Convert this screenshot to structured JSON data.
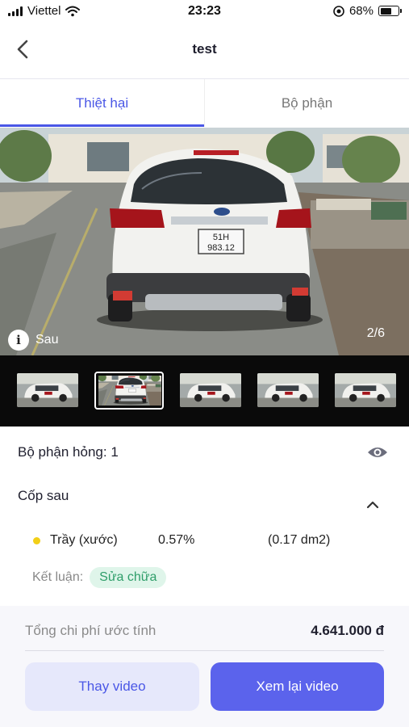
{
  "status_bar": {
    "carrier": "Viettel",
    "time": "23:23",
    "battery": "68%",
    "battery_level": 0.68
  },
  "header": {
    "title": "test"
  },
  "tabs": [
    {
      "label": "Thiệt hại",
      "active": true
    },
    {
      "label": "Bộ phận",
      "active": false
    }
  ],
  "photo": {
    "caption": "Sau",
    "counter": "2/6",
    "plate_line1": "51H",
    "plate_line2": "983.12"
  },
  "thumbnails": {
    "count": 5,
    "selected_index": 1
  },
  "details": {
    "parts_label": "Bộ phận hỏng: 1",
    "part_name": "Cốp sau",
    "damage": {
      "type": "Trầy (xước)",
      "percent": "0.57%",
      "area": "(0.17 dm2)"
    },
    "conclusion_label": "Kết luận:",
    "conclusion_value": "Sửa chữa"
  },
  "footer": {
    "total_label": "Tổng chi phí ước tính",
    "total_value": "4.641.000 đ",
    "replace_button": "Thay video",
    "review_button": "Xem lại video"
  },
  "colors": {
    "accent": "#4a57e6",
    "primary_button": "#5b63ec",
    "secondary_button": "#e6e8fb",
    "repair_pill_bg": "#dff5ea",
    "repair_pill_text": "#2f9e6a",
    "damage_dot": "#f2cf17"
  },
  "icons": [
    "wifi-icon",
    "location-icon",
    "battery-icon",
    "back-arrow-icon",
    "info-icon",
    "eye-icon",
    "chevron-up-icon"
  ]
}
